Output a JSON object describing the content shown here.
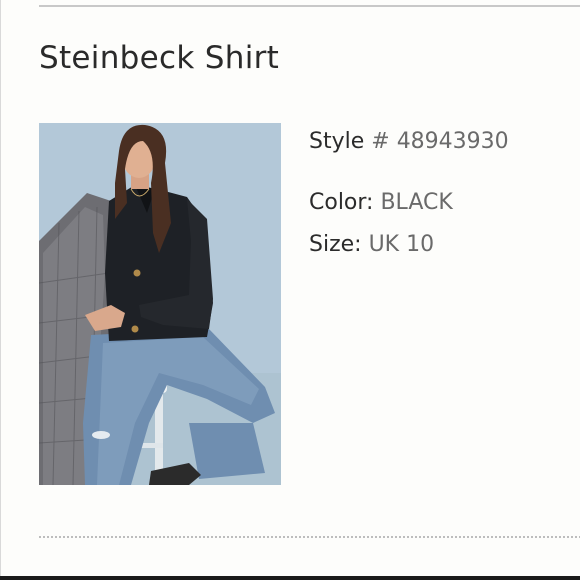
{
  "product": {
    "title": "Steinbeck Shirt",
    "photo_alt": "Model wearing black Steinbeck Shirt with jeans and a plaid coat, seated on a stool",
    "details": {
      "style_label": "Style",
      "style_symbol": " # ",
      "style_value": "48943930",
      "color_label": "Color: ",
      "color_value": "BLACK",
      "size_label": "Size: ",
      "size_value": "UK 10"
    }
  },
  "colors": {
    "text_primary": "#2a2a2a",
    "text_secondary": "#6a6a6a",
    "background": "#fdfdfb",
    "rule": "#c8c8c8"
  }
}
